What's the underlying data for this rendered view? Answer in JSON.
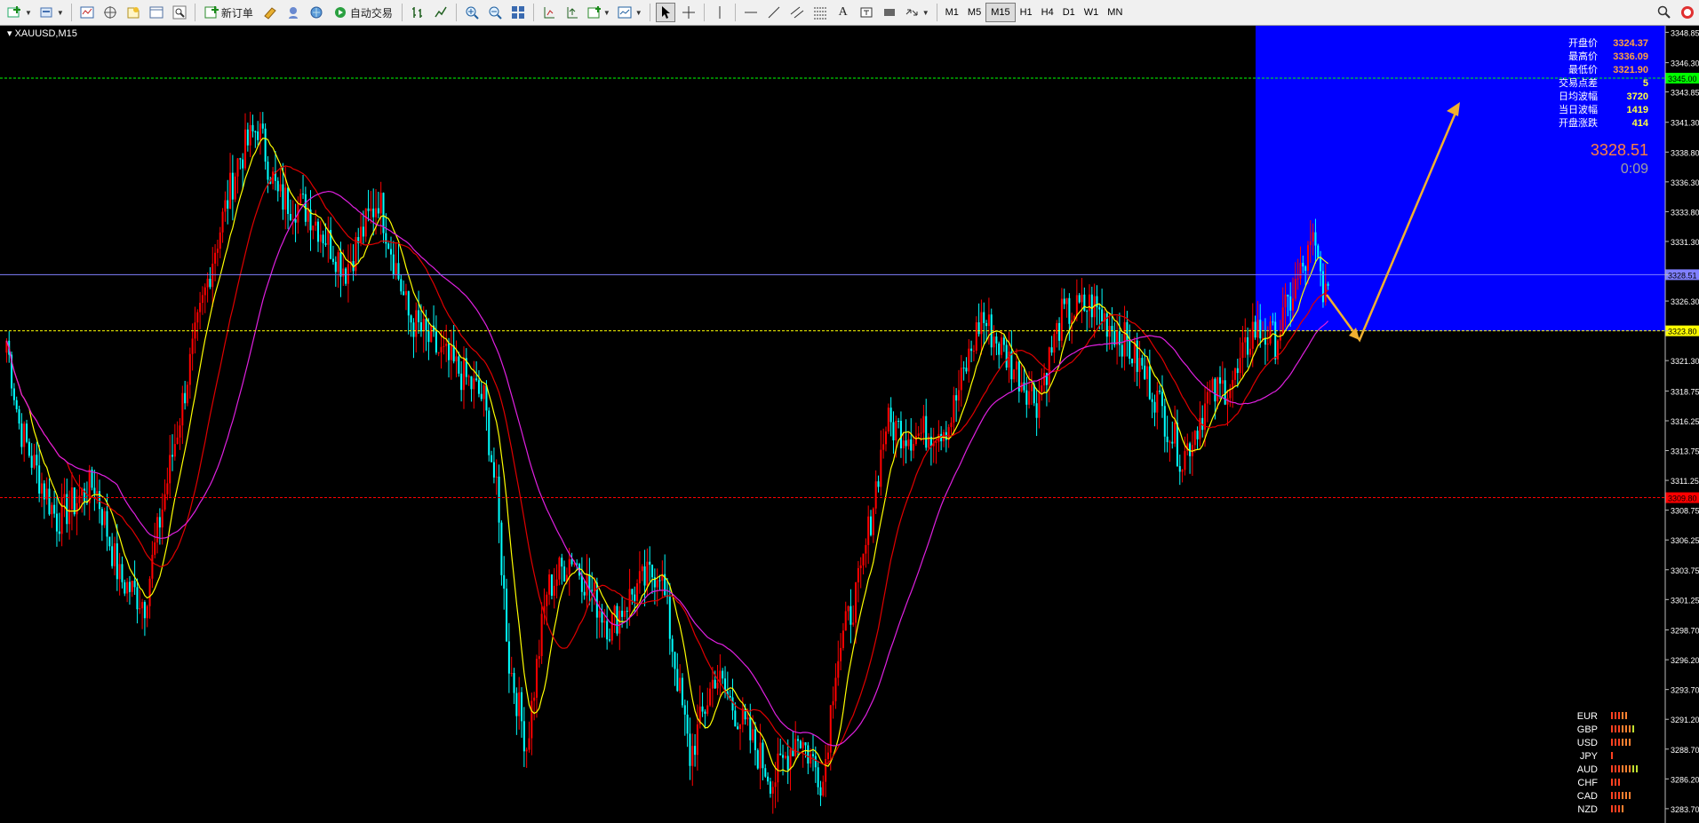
{
  "toolbar": {
    "new_order_label": "新订单",
    "auto_trading_label": "自动交易",
    "timeframes": [
      "M1",
      "M5",
      "M15",
      "H1",
      "H4",
      "D1",
      "W1",
      "MN"
    ],
    "active_timeframe": "M15"
  },
  "chart": {
    "symbol_title": "XAUUSD,M15",
    "background_color": "#000000",
    "bull_color": "#ff0000",
    "bear_color": "#00ffff",
    "highlight_color": "#0000ff",
    "price_axis_ticks": [
      "3348.85",
      "3346.30",
      "3343.85",
      "3341.30",
      "3338.80",
      "3336.30",
      "3333.80",
      "3331.30",
      "3328.51",
      "3326.30",
      "3323.80",
      "3321.30",
      "3318.75",
      "3316.25",
      "3313.75",
      "3311.25",
      "3308.75",
      "3306.25",
      "3303.75",
      "3301.25",
      "3298.70",
      "3296.20",
      "3293.70",
      "3291.20",
      "3288.70",
      "3286.20",
      "3283.70"
    ],
    "y_range": [
      3282.5,
      3349.4
    ],
    "level_lines": [
      {
        "price": 3345.0,
        "label": "3345.00",
        "color": "#00ff00",
        "style": "dashed"
      },
      {
        "price": 3328.51,
        "label": "3328.51",
        "color": "#8080ff",
        "style": "solid"
      },
      {
        "price": 3323.8,
        "label": "3323.80",
        "color": "#ffff00",
        "style": "dashed"
      },
      {
        "price": 3309.8,
        "label": "3309.80",
        "color": "#ff0000",
        "style": "dashed"
      }
    ]
  },
  "info_panel": {
    "rows": [
      {
        "label": "开盘价",
        "value": "3324.37"
      },
      {
        "label": "最高价",
        "value": "3336.09"
      },
      {
        "label": "最低价",
        "value": "3321.90"
      },
      {
        "label": "交易点差",
        "value": "5"
      },
      {
        "label": "日均波幅",
        "value": "3720"
      },
      {
        "label": "当日波幅",
        "value": "1419"
      },
      {
        "label": "开盘涨跌",
        "value": "414"
      }
    ],
    "current_price": "3328.51",
    "timer": "0:09"
  },
  "currency_strength": [
    {
      "currency": "EUR",
      "level": 5
    },
    {
      "currency": "GBP",
      "level": 7
    },
    {
      "currency": "USD",
      "level": 6
    },
    {
      "currency": "JPY",
      "level": 1
    },
    {
      "currency": "AUD",
      "level": 8
    },
    {
      "currency": "CHF",
      "level": 3
    },
    {
      "currency": "CAD",
      "level": 6
    },
    {
      "currency": "NZD",
      "level": 4
    }
  ],
  "icons": [
    "new-chart-icon",
    "profiles-icon",
    "market-watch-icon",
    "navigator-icon",
    "terminal-icon",
    "strategy-tester-icon",
    "new-order-icon",
    "metaeditor-icon",
    "options-icon",
    "signals-icon",
    "auto-trading-icon",
    "bar-chart-icon",
    "line-chart-icon",
    "zoom-in-icon",
    "zoom-out-icon",
    "tile-windows-icon",
    "autoscroll-icon",
    "chart-shift-icon",
    "indicators-icon",
    "periods-icon",
    "cursor-icon",
    "crosshair-icon",
    "vertical-line-icon",
    "horizontal-line-icon",
    "trendline-icon",
    "channel-icon",
    "fibonacci-icon",
    "text-icon",
    "label-icon",
    "arrows-icon",
    "search-icon",
    "notifications-icon"
  ]
}
